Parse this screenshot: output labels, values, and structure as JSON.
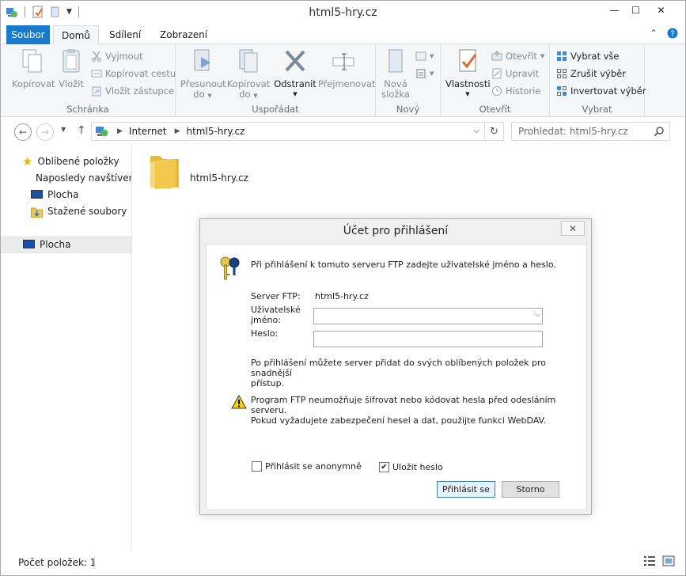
{
  "window": {
    "title": "html5-hry.cz",
    "controls": {
      "minimize": "—",
      "maximize": "☐",
      "close": "✕"
    }
  },
  "ribbon_tabs": [
    {
      "label": "Soubor"
    },
    {
      "label": "Domů"
    },
    {
      "label": "Sdílení"
    },
    {
      "label": "Zobrazení"
    }
  ],
  "ribbon": {
    "clipboard": {
      "label": "Schránka",
      "copy": "Kopírovat",
      "paste": "Vložit",
      "cut": "Vyjmout",
      "copy_path": "Kopírovat cestu",
      "paste_shortcut": "Vložit zástupce"
    },
    "organize": {
      "label": "Uspořádat",
      "move_to_1": "Přesunout",
      "move_to_2": "do",
      "copy_to_1": "Kopírovat",
      "copy_to_2": "do",
      "delete": "Odstranit",
      "rename": "Přejmenovat"
    },
    "new": {
      "label": "Nový",
      "new_folder_1": "Nová",
      "new_folder_2": "složka"
    },
    "open": {
      "label": "Otevřít",
      "properties": "Vlastnosti",
      "open": "Otevřít",
      "edit": "Upravit",
      "history": "Historie"
    },
    "select": {
      "label": "Vybrat",
      "select_all": "Vybrat vše",
      "select_none": "Zrušit výběr",
      "invert": "Invertovat výběr"
    }
  },
  "address": {
    "crumbs": [
      "Internet",
      "html5-hry.cz"
    ],
    "search_placeholder": "Prohledat: html5-hry.cz"
  },
  "nav_pane": {
    "favorites": "Oblíbené položky",
    "recent": "Naposledy navštívené",
    "desktop_fav": "Plocha",
    "downloads": "Stažené soubory",
    "desktop": "Plocha"
  },
  "content": {
    "folder_name": "html5-hry.cz"
  },
  "status": {
    "item_count": "Počet položek: 1"
  },
  "dialog": {
    "title": "Účet pro přihlášení",
    "intro": "Při přihlášení k tomuto serveru FTP zadejte uživatelské jméno a heslo.",
    "server_label": "Server FTP:",
    "server_value": "html5-hry.cz",
    "username_label_1": "Uživatelské",
    "username_label_2": "jméno:",
    "username_value": "",
    "password_label": "Heslo:",
    "password_value": "",
    "info_1": "Po přihlášení můžete server přidat do svých oblíbených položek pro snadnější",
    "info_2": "přístup.",
    "warning_1": "Program FTP neumožňuje šifrovat nebo kódovat hesla před odesláním serveru.",
    "warning_2": "Pokud vyžadujete zabezpečení hesel a dat, použijte funkci WebDAV.",
    "anonymous_label": "Přihlásit se anonymně",
    "anonymous_checked": false,
    "save_password_label": "Uložit heslo",
    "save_password_checked": true,
    "login_button": "Přihlásit se",
    "cancel_button": "Storno"
  },
  "colors": {
    "file_tab": "#1979ca",
    "ribbon_bg": "#f5f6f7",
    "dialog_bg": "#f0f0f0",
    "folder_yellow": "#f2c94c"
  }
}
